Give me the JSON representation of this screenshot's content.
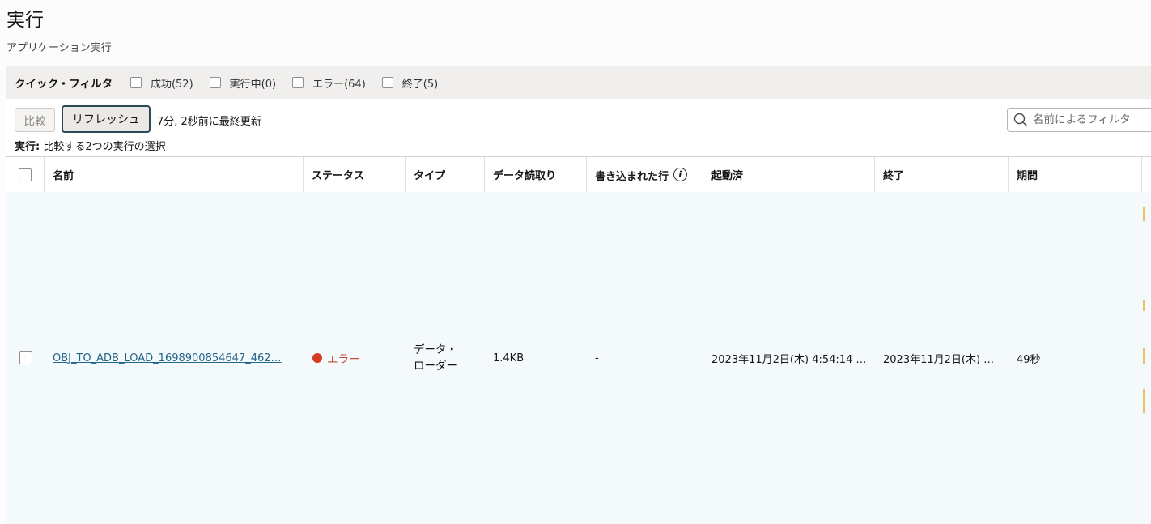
{
  "header": {
    "title": "実行",
    "subtitle": "アプリケーション実行"
  },
  "quick_filter": {
    "title": "クイック・フィルタ",
    "options": [
      {
        "label": "成功(52)",
        "checked": false
      },
      {
        "label": "実行中(0)",
        "checked": false
      },
      {
        "label": "エラー(64)",
        "checked": false
      },
      {
        "label": "終了(5)",
        "checked": false
      }
    ]
  },
  "toolbar": {
    "compare_label": "比較",
    "refresh_label": "リフレッシュ",
    "last_updated": "7分, 2秒前に最終更新",
    "select_hint_bold": "実行:",
    "select_hint_text": " 比較する2つの実行の選択",
    "search_placeholder": "名前によるフィルタ"
  },
  "table": {
    "columns": [
      "名前",
      "ステータス",
      "タイプ",
      "データ読取り",
      "書き込まれた行",
      "起動済",
      "終了",
      "期間"
    ],
    "rows": [
      {
        "name": "OBJ_TO_ADB_LOAD_1698900854647_462…",
        "status": "エラー",
        "type_line1": "データ・",
        "type_line2": "ローダー",
        "data_read": "1.4KB",
        "rows_written": "-",
        "started": "2023年11月2日(木) 4:54:14 …",
        "ended": "2023年11月2日(木) …",
        "duration": "49秒"
      }
    ]
  },
  "colors": {
    "error": "#d63b25",
    "link": "#22658a",
    "row_highlight": "#f4f9fc"
  }
}
